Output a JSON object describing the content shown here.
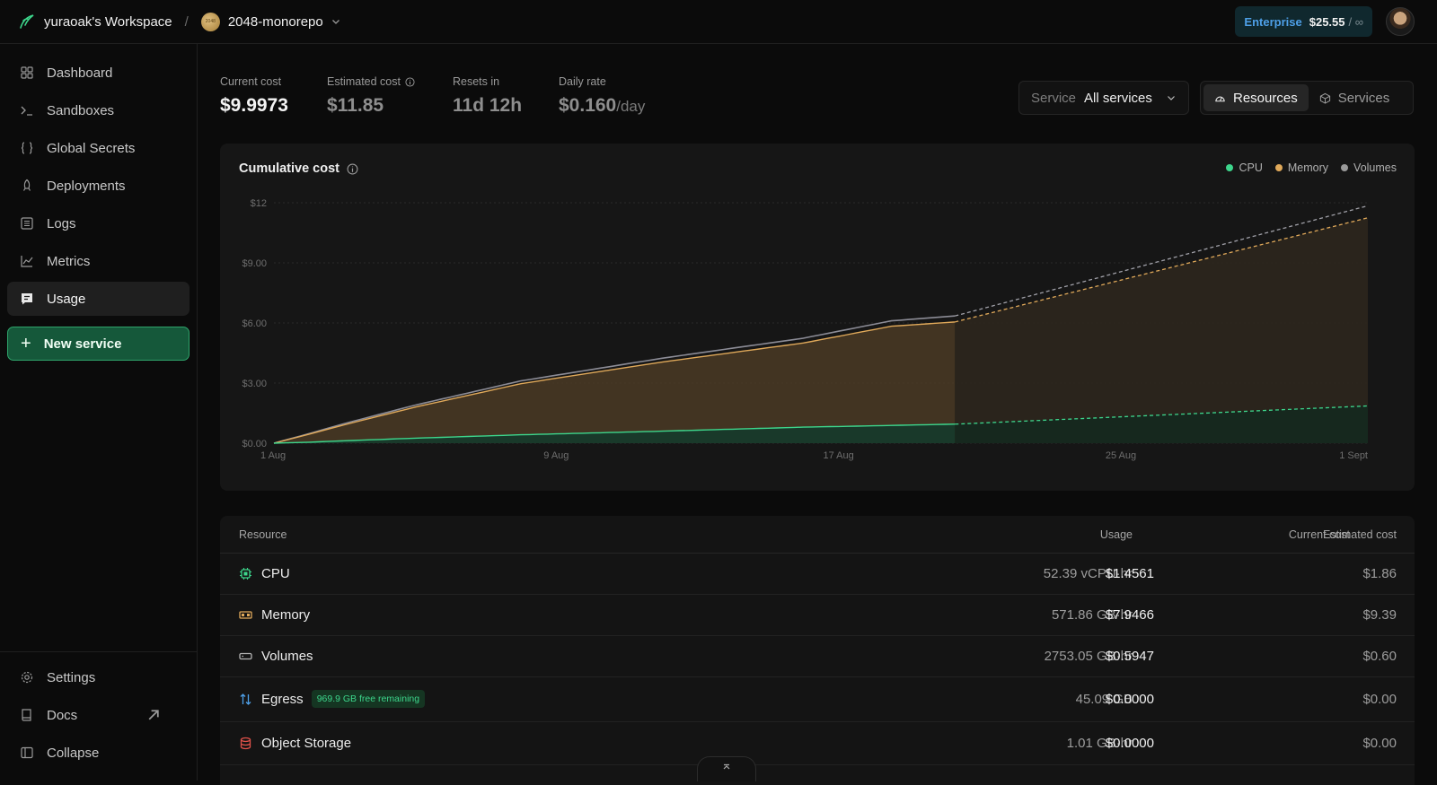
{
  "topbar": {
    "workspace": "yuraoak's Workspace",
    "separator": "/",
    "project_badge": "2048",
    "project": "2048-monorepo",
    "plan_tier": "Enterprise",
    "plan_amount": "$25.55",
    "plan_limit": "/ ∞"
  },
  "sidebar": {
    "items": [
      {
        "label": "Dashboard",
        "icon": "grid-icon"
      },
      {
        "label": "Sandboxes",
        "icon": "terminal-icon"
      },
      {
        "label": "Global Secrets",
        "icon": "braces-icon"
      },
      {
        "label": "Deployments",
        "icon": "rocket-icon"
      },
      {
        "label": "Logs",
        "icon": "log-list-icon"
      },
      {
        "label": "Metrics",
        "icon": "line-chart-icon"
      },
      {
        "label": "Usage",
        "icon": "receipt-icon"
      }
    ],
    "new_service": "New service",
    "bottom": [
      {
        "label": "Settings",
        "icon": "gear-icon"
      },
      {
        "label": "Docs",
        "icon": "book-icon"
      },
      {
        "label": "Collapse",
        "icon": "sidebar-collapse-icon"
      }
    ]
  },
  "stats": {
    "current_cost": {
      "label": "Current cost",
      "value": "$9.9973"
    },
    "estimated_cost": {
      "label": "Estimated cost",
      "value": "$11.85"
    },
    "resets_in": {
      "label": "Resets in",
      "value": "11d 12h"
    },
    "daily_rate": {
      "label": "Daily rate",
      "value": "$0.160",
      "unit": "/day"
    }
  },
  "filters": {
    "service_label": "Service",
    "service_value": "All services",
    "view_resources": "Resources",
    "view_services": "Services"
  },
  "chart": {
    "title": "Cumulative cost",
    "legend": [
      {
        "name": "CPU",
        "color": "#3dd68c"
      },
      {
        "name": "Memory",
        "color": "#e0a95a"
      },
      {
        "name": "Volumes",
        "color": "#9a9a9a"
      }
    ]
  },
  "chart_data": {
    "type": "area",
    "title": "Cumulative cost",
    "x_ticks": [
      "1 Aug",
      "9 Aug",
      "17 Aug",
      "25 Aug",
      "1 Sept"
    ],
    "y_ticks": [
      "$0.00",
      "$3.00",
      "$6.00",
      "$9.00",
      "$12"
    ],
    "ylim": [
      0,
      12
    ],
    "x_domain_days": [
      1,
      32
    ],
    "actual_end_day": 20.3,
    "stacked": true,
    "series": [
      {
        "name": "CPU",
        "color": "#3dd68c",
        "x": [
          1,
          2,
          3,
          5,
          8,
          12,
          16,
          20.3
        ],
        "values": [
          0,
          0.05,
          0.12,
          0.25,
          0.42,
          0.6,
          0.8,
          0.95
        ],
        "projected": {
          "x": [
            20.3,
            32
          ],
          "values": [
            0.95,
            1.86
          ]
        }
      },
      {
        "name": "Memory",
        "color": "#e0a95a",
        "x": [
          1,
          2,
          3,
          5,
          8,
          12,
          16,
          18.5,
          20.3
        ],
        "values": [
          0,
          0.4,
          0.8,
          1.55,
          2.55,
          3.45,
          4.2,
          4.95,
          5.1
        ],
        "projected": {
          "x": [
            20.3,
            32
          ],
          "values": [
            5.1,
            9.39
          ]
        }
      },
      {
        "name": "Volumes",
        "color": "#9a9a9a",
        "x": [
          1,
          2,
          3,
          5,
          8,
          12,
          16,
          18.5,
          20.3
        ],
        "values": [
          0,
          0.03,
          0.06,
          0.1,
          0.14,
          0.19,
          0.24,
          0.27,
          0.3
        ],
        "projected": {
          "x": [
            20.3,
            32
          ],
          "values": [
            0.3,
            0.6
          ]
        }
      }
    ]
  },
  "table": {
    "headers": {
      "resource": "Resource",
      "usage": "Usage",
      "current": "Current cost",
      "estimated": "Estimated cost"
    },
    "rows": [
      {
        "name": "CPU",
        "icon": "cpu-icon",
        "icon_color": "#3dd68c",
        "usage": "52.39 vCPU·hr",
        "current": "$1.4561",
        "estimated": "$1.86"
      },
      {
        "name": "Memory",
        "icon": "memory-icon",
        "icon_color": "#e0a95a",
        "usage": "571.86 GB·hr",
        "current": "$7.9466",
        "estimated": "$9.39"
      },
      {
        "name": "Volumes",
        "icon": "disk-icon",
        "icon_color": "#b5b5b5",
        "usage": "2753.05 GB·hr",
        "current": "$0.5947",
        "estimated": "$0.60"
      },
      {
        "name": "Egress",
        "icon": "arrows-updown-icon",
        "icon_color": "#4ea0e8",
        "badge": "969.9 GB free remaining",
        "usage": "45.09 GB",
        "current": "$0.0000",
        "estimated": "$0.00"
      },
      {
        "name": "Object Storage",
        "icon": "database-icon",
        "icon_color": "#e0524a",
        "usage": "1.01 GB·hr",
        "current": "$0.0000",
        "estimated": "$0.00"
      }
    ]
  }
}
